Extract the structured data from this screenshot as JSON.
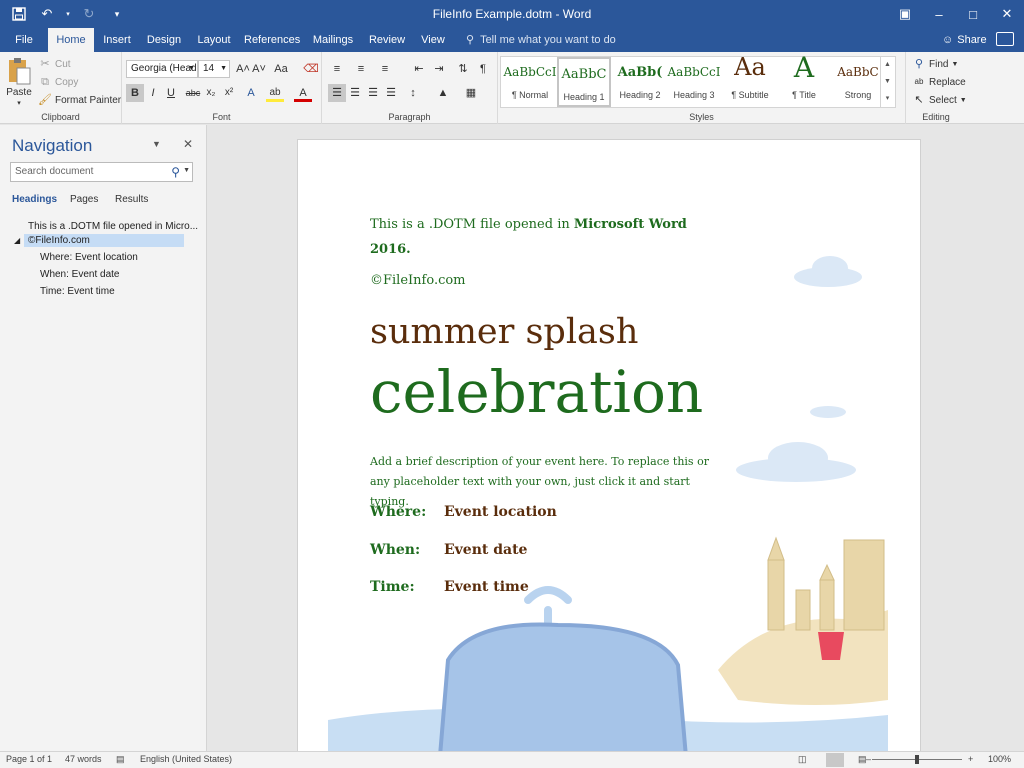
{
  "titlebar": {
    "title": "FileInfo Example.dotm  -  Word",
    "qat": {
      "save_icon": "save-icon",
      "undo_icon": "undo-icon",
      "redo_icon": "redo-icon",
      "customize_icon": "customize-icon"
    },
    "window_controls": [
      "ribbon-display-icon",
      "minimize-icon",
      "maximize-icon",
      "close-icon"
    ]
  },
  "tabs": [
    "File",
    "Home",
    "Insert",
    "Design",
    "Layout",
    "References",
    "Mailings",
    "Review",
    "View"
  ],
  "active_tab": "Home",
  "tell_me": "Tell me what you want to do",
  "share": "Share",
  "ribbon": {
    "clipboard": {
      "label": "Clipboard",
      "paste": "Paste",
      "cut": "Cut",
      "copy": "Copy",
      "format_painter": "Format Painter"
    },
    "font": {
      "label": "Font",
      "family": "Georgia (Head",
      "size": "14",
      "bold": "B",
      "italic": "I",
      "underline": "U",
      "strike": "abc",
      "sub": "x₂",
      "sup": "x²",
      "grow": "A˄",
      "shrink": "A˅",
      "case": "Aa",
      "clear": "⌫",
      "effects": "A",
      "highlight": "ab",
      "color": "A"
    },
    "paragraph": {
      "label": "Paragraph",
      "pilcrow": "¶"
    },
    "styles": {
      "label": "Styles",
      "items": [
        {
          "preview": "AaBbCcI",
          "name": "¶ Normal"
        },
        {
          "preview": "AaBbC",
          "name": "Heading 1"
        },
        {
          "preview": "AaBb(",
          "name": "Heading 2"
        },
        {
          "preview": "AaBbCcI",
          "name": "Heading 3"
        },
        {
          "preview": "Aa",
          "name": "¶ Subtitle"
        },
        {
          "preview": "A",
          "name": "¶ Title"
        },
        {
          "preview": "AaBbC",
          "name": "Strong"
        }
      ]
    },
    "editing": {
      "label": "Editing",
      "find": "Find",
      "replace": "Replace",
      "select": "Select"
    }
  },
  "nav": {
    "title": "Navigation",
    "search_placeholder": "Search document",
    "tabs": [
      "Headings",
      "Pages",
      "Results"
    ],
    "active_tab": "Headings",
    "headings": [
      {
        "text": "This is a .DOTM file opened in Micro..."
      },
      {
        "text": "©FileInfo.com",
        "selected": true
      },
      {
        "text": "Where:  Event location"
      },
      {
        "text": "When:  Event date"
      },
      {
        "text": "Time:  Event time"
      }
    ]
  },
  "document": {
    "intro_1": "This is a .DOTM file opened in ",
    "intro_bold": "Microsoft Word 2016.",
    "copyright": "©FileInfo.com",
    "title_1": "summer splash",
    "title_2": "celebration",
    "description": "Add a brief description of your event here. To replace this or any placeholder text with your own, just click it and start typing.",
    "details": [
      {
        "label": "Where:",
        "value": "Event location"
      },
      {
        "label": "When:",
        "value": "Event date"
      },
      {
        "label": "Time:",
        "value": "Event time"
      }
    ]
  },
  "status": {
    "page": "Page 1 of 1",
    "words": "47 words",
    "language": "English (United States)",
    "zoom": "100%",
    "zoom_level_percent": 100
  },
  "colors": {
    "accent": "#2b579a",
    "green_text": "#1e6b1e",
    "brown_text": "#5a2d0c",
    "whale": "#a6c4e8",
    "sand": "#f0dfb8"
  }
}
